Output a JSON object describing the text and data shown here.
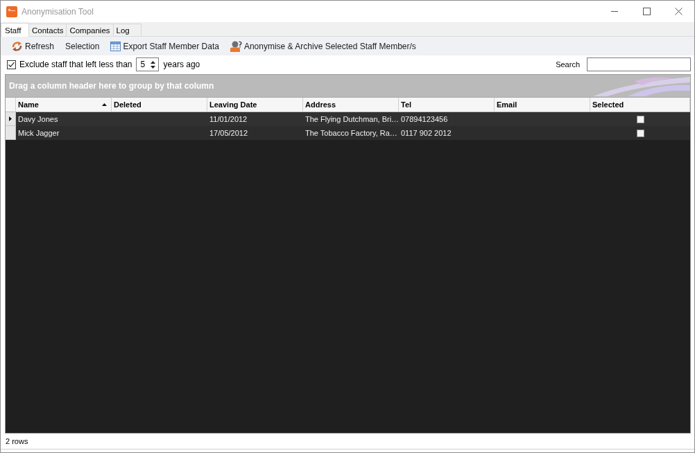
{
  "window": {
    "title": "Anonymisation Tool"
  },
  "tabs": [
    {
      "label": "Staff",
      "selected": true
    },
    {
      "label": "Contacts",
      "selected": false
    },
    {
      "label": "Companies",
      "selected": false
    },
    {
      "label": "Log",
      "selected": false
    }
  ],
  "toolbar": [
    {
      "kind": "refresh",
      "label": "Refresh"
    },
    {
      "kind": "plain",
      "label": "Selection"
    },
    {
      "kind": "export",
      "label": "Export Staff Member Data"
    },
    {
      "kind": "archive",
      "label": "Anonymise & Archive Selected Staff Member/s"
    }
  ],
  "filter": {
    "exclude": {
      "label": "Exclude staff that left less than",
      "checked": true
    },
    "years": {
      "value": "5",
      "suffix": "years ago"
    },
    "search": {
      "label": "Search"
    }
  },
  "grid": {
    "group_hint": "Drag a column header here to group by that column",
    "columns": [
      {
        "label": "Name",
        "sort_ascending": true
      },
      {
        "label": "Deleted",
        "sort_ascending": false
      },
      {
        "label": "Leaving Date",
        "sort_ascending": false
      },
      {
        "label": "Address",
        "sort_ascending": false
      },
      {
        "label": "Tel",
        "sort_ascending": false
      },
      {
        "label": "Email",
        "sort_ascending": false
      },
      {
        "label": "Selected",
        "sort_ascending": false
      }
    ],
    "rows": [
      {
        "current": true,
        "name": "Davy Jones",
        "leaving_date": "11/01/2012",
        "address": "The Flying Dutchman, Bri…",
        "tel": "07894123456",
        "checked": false
      },
      {
        "current": false,
        "name": "Mick Jagger",
        "leaving_date": "17/05/2012",
        "address": "The Tobacco Factory, Ra…",
        "tel": "0117 902 2012",
        "checked": false
      }
    ]
  },
  "status_bar": {
    "text": "2 rows"
  }
}
